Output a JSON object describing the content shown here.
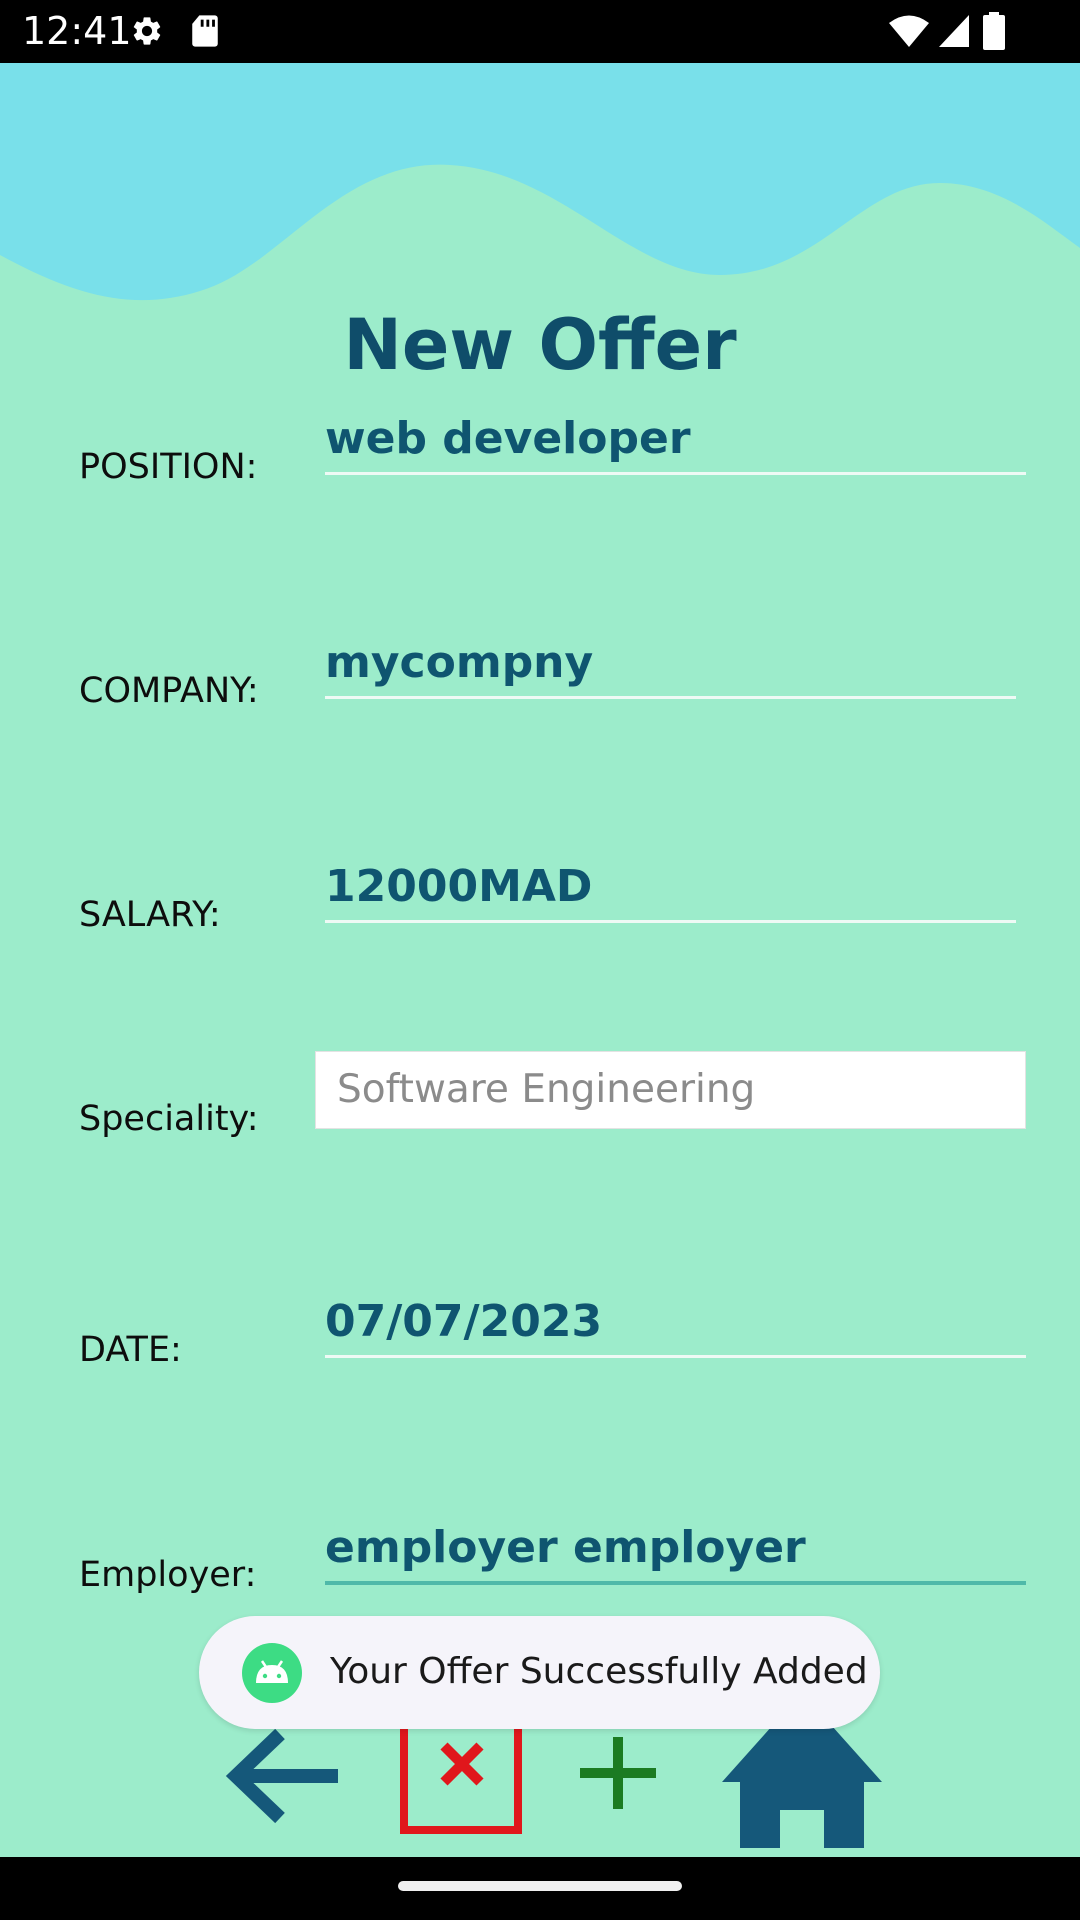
{
  "status_bar": {
    "time": "12:41",
    "icons": [
      "settings-icon",
      "sd-card-icon",
      "wifi-icon",
      "signal-icon",
      "battery-icon"
    ]
  },
  "screen": {
    "title": "New Offer",
    "colors": {
      "background": "#9ceccb",
      "wave": "#79e0ea",
      "title": "#0f4d6a",
      "value": "#0f5570",
      "delete_red": "#e0171c",
      "add_green": "#1b7b22",
      "nav_blue": "#15587a"
    }
  },
  "form": {
    "position": {
      "label": "POSITION:",
      "value": "web developer"
    },
    "company": {
      "label": "COMPANY:",
      "value": "mycompny"
    },
    "salary": {
      "label": "SALARY:",
      "value": "12000MAD"
    },
    "speciality": {
      "label": "Speciality:",
      "value": "Software Engineering"
    },
    "date": {
      "label": "DATE:",
      "value": "07/07/2023"
    },
    "employer": {
      "label": "Employer:",
      "value": "employer employer"
    }
  },
  "toast": {
    "message": "Your Offer Successfully Added",
    "icon": "android-icon"
  },
  "bottom_actions": {
    "icons": [
      "back-arrow-icon",
      "delete-icon",
      "add-icon",
      "home-icon"
    ]
  }
}
